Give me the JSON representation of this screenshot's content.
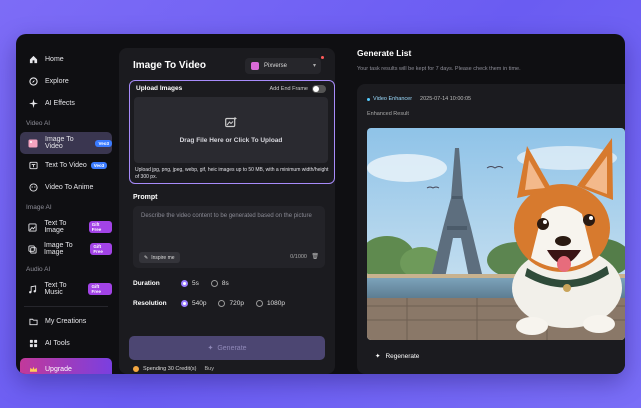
{
  "sidebar": {
    "items_top": [
      {
        "label": "Home",
        "icon": "home-icon"
      },
      {
        "label": "Explore",
        "icon": "compass-icon"
      },
      {
        "label": "AI Effects",
        "icon": "sparkle-icon"
      }
    ],
    "section_video": "Video AI",
    "video_items": [
      {
        "label": "Image To Video",
        "badge": "Veo3",
        "active": true
      },
      {
        "label": "Text To Video",
        "badge": "Veo3"
      },
      {
        "label": "Video To Anime"
      }
    ],
    "section_image": "Image AI",
    "image_items": [
      {
        "label": "Text To Image",
        "badge": "Gift Free"
      },
      {
        "label": "Image To Image",
        "badge": "Gift Free"
      }
    ],
    "section_audio": "Audio AI",
    "audio_items": [
      {
        "label": "Text To Music",
        "badge": "Gift Free"
      }
    ],
    "items_bottom": [
      {
        "label": "My Creations"
      },
      {
        "label": "AI Tools"
      }
    ],
    "upgrade": "Upgrade"
  },
  "panel": {
    "title": "Image To Video",
    "model": "Pixverse",
    "upload_label": "Upload Images",
    "end_frame": "Add End Frame",
    "drop_text": "Drag File Here or Click To Upload",
    "upload_hint": "Upload jpg, png, jpeg, webp, gif, heic images up to 50 MB, with a minimum width/height of 300 px.",
    "prompt_label": "Prompt",
    "prompt_placeholder": "Describe the video content to be generated based on the picture",
    "inspire": "Inspire me",
    "counter": "0/1000",
    "duration_label": "Duration",
    "duration_options": [
      "5s",
      "8s"
    ],
    "resolution_label": "Resolution",
    "resolution_options": [
      "540p",
      "720p",
      "1080p"
    ],
    "generate": "Generate",
    "credits": "Spending 30 Credit(s)",
    "buy": "Buy"
  },
  "right": {
    "title": "Generate List",
    "subtitle": "Your task results will be kept for 7 days. Please check them in time.",
    "tag": "Video Enhancer",
    "timestamp": "2025-07-14 10:00:05",
    "enhanced": "Enhanced Result",
    "regenerate": "Regenerate"
  },
  "colors": {
    "accent": "#9a7cff",
    "background": "#0f0f12",
    "panel": "#1b1b1f"
  }
}
